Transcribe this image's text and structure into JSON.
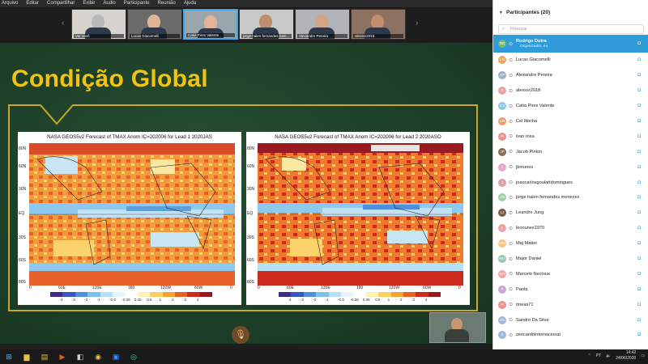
{
  "menu": [
    "Arquivo",
    "Editar",
    "Compartilhar",
    "Exibir",
    "Áudio",
    "Participante",
    "Reunião",
    "Ajuda"
  ],
  "video_strip": [
    {
      "name": "Ver você",
      "face": "#b9b9b9",
      "bg": "#d7d4cf",
      "active": false
    },
    {
      "name": "Lucas Giacomelli",
      "face": "#e0b497",
      "bg": "#6a6a6a",
      "active": false
    },
    {
      "name": "Catia Pires Valente",
      "face": "#e2b59a",
      "bg": "#9aa6ae",
      "active": true
    },
    {
      "name": "jorge halen fernandes men...",
      "face": "#bf8f6f",
      "bg": "#c9c9c9",
      "active": false
    },
    {
      "name": "Alexandre Pereira",
      "face": "#d6a384",
      "bg": "#b0b4b8",
      "active": false
    },
    {
      "name": "alexssr2018",
      "face": "#c48d6c",
      "bg": "#8d7261",
      "active": false
    }
  ],
  "slide": {
    "title": "Condição Global",
    "maps": [
      {
        "title": "NASA GEOS5v2 Forecast of TMAX Anom IC=202006 for Lead 1 2020JAS"
      },
      {
        "title": "NASA GEOS5v2 Forecast of TMAX Anom IC=202006 for Lead 2 2020ASO"
      }
    ],
    "y_labels": [
      "80N",
      "60N",
      "30N",
      "EQ",
      "30S",
      "60S",
      "80S"
    ],
    "x_labels": [
      "0",
      "60E",
      "120E",
      "180",
      "120W",
      "60W",
      "0"
    ],
    "colorbar_labels": [
      "-4",
      "-3",
      "-2",
      "-1",
      "-0.5",
      "-0.25",
      "0.25",
      "0.5",
      "1",
      "2",
      "3",
      "4"
    ],
    "colorbar_colors": [
      "#3d2a8c",
      "#3556c9",
      "#4e8fe0",
      "#7cc0ee",
      "#b6e0f7",
      "#e8f4fb",
      "#ffffff",
      "#fff2b0",
      "#fdd060",
      "#f7a230",
      "#ea6222",
      "#cc2a1c",
      "#9a1a22"
    ]
  },
  "participants_panel": {
    "title": "Participantes (20)",
    "search_placeholder": "Procurar",
    "people": [
      {
        "name": "Rodrigo Dutra",
        "role": "Organizador, eu",
        "initials": "RD",
        "color": "#6fbf73",
        "selected": true
      },
      {
        "name": "Lucas Giacomelli",
        "initials": "LG",
        "color": "#f0a35e"
      },
      {
        "name": "Alexandre Pereira",
        "initials": "AP",
        "color": "#9ab0c7"
      },
      {
        "name": "alexssr2018",
        "initials": "A",
        "color": "#e9a3a3"
      },
      {
        "name": "Catia Pires Valente",
        "initials": "CV",
        "color": "#8ec6e8"
      },
      {
        "name": "Cel Rocha",
        "initials": "CR",
        "color": "#f29a6a"
      },
      {
        "name": "ivan rosa",
        "initials": "IR",
        "color": "#ef8f8f"
      },
      {
        "name": "Jacob Pinton",
        "initials": "JP",
        "color": "#8b6a50"
      },
      {
        "name": "jbmunes",
        "initials": "J",
        "color": "#e7a7c7"
      },
      {
        "name": "joaocarlosgoulartdomingues",
        "initials": "J",
        "color": "#e0a0a0"
      },
      {
        "name": "jorge halen fernandes menezes",
        "initials": "JM",
        "color": "#9fd0a5"
      },
      {
        "name": "Leandro Jung",
        "initials": "LJ",
        "color": "#7a5e4a"
      },
      {
        "name": "leonunes1970",
        "initials": "L",
        "color": "#e9a3a3"
      },
      {
        "name": "Maj Mattei",
        "initials": "MM",
        "color": "#f4c27a"
      },
      {
        "name": "Major Daniel",
        "initials": "MD",
        "color": "#8fc7b3"
      },
      {
        "name": "Marcelo Nectoux",
        "initials": "MN",
        "color": "#f0a3a3"
      },
      {
        "name": "Paola",
        "initials": "P",
        "color": "#c7a6d8"
      },
      {
        "name": "rineas71",
        "initials": "R",
        "color": "#ef8f8f"
      },
      {
        "name": "Sandro Da Silva",
        "initials": "SS",
        "color": "#9ab8e0"
      },
      {
        "name": "zericardointernacional",
        "initials": "Z",
        "color": "#9ab8e0"
      }
    ]
  },
  "taskbar": {
    "lang": "PT",
    "time": "14:42",
    "date": "24/06/2020"
  },
  "colors": {
    "accent": "#2f9bd9",
    "slide_bg": "#1a3d26",
    "title_yellow": "#f2c313",
    "frame_yellow": "#c9a825"
  }
}
